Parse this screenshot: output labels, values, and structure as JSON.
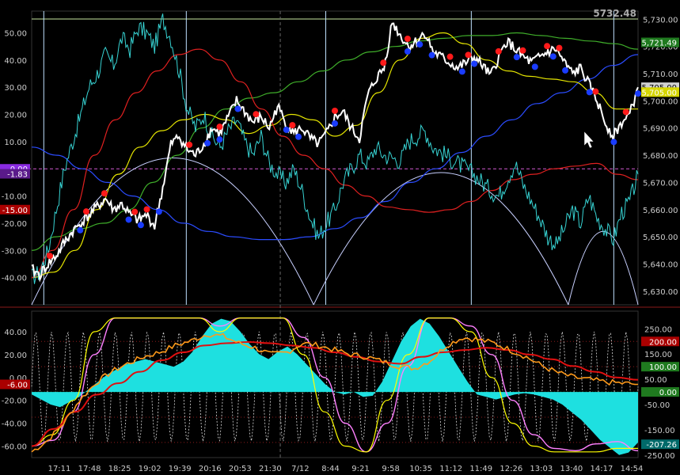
{
  "chart_data": [
    {
      "type": "line",
      "panel": "price",
      "header_value": "5732.48",
      "left_axis": {
        "ylim": [
          -50,
          58
        ],
        "ticks": [
          "50.00",
          "40.00",
          "30.00",
          "20.00",
          "10.00",
          "0.00",
          "-10.00",
          "-20.00",
          "-30.00",
          "-40.00"
        ],
        "tick_values": [
          50,
          40,
          30,
          20,
          10,
          0,
          -10,
          -20,
          -30,
          -40
        ]
      },
      "right_axis": {
        "ylim": [
          5625,
          5733
        ],
        "ticks": [
          "5,730.00",
          "5,720.00",
          "5,710.00",
          "5,700.00",
          "5,690.00",
          "5,680.00",
          "5,670.00",
          "5,660.00",
          "5,650.00",
          "5,640.00",
          "5,630.00"
        ],
        "tick_values": [
          5730,
          5720,
          5710,
          5700,
          5690,
          5680,
          5670,
          5660,
          5650,
          5640,
          5630
        ]
      },
      "badges": [
        {
          "side": "left",
          "text": "0.00",
          "value": 0,
          "bg": "#8a2be2"
        },
        {
          "side": "left",
          "text": "-1.83",
          "value": -1.83,
          "bg": "#5a1a8a"
        },
        {
          "side": "left",
          "text": "-15.00",
          "value": -15,
          "bg": "#aa0000"
        },
        {
          "side": "right",
          "text": "5,721.49",
          "value": 5721.49,
          "bg": "#1f7a1f"
        },
        {
          "side": "right",
          "text": "5,705.00",
          "value": 5705,
          "bg": "#d0d0d0"
        },
        {
          "side": "right",
          "text": "5,705.00",
          "value": 5703.2,
          "bg": "#d6d600"
        }
      ],
      "price_series": [
        5638,
        5636,
        5640,
        5643,
        5648,
        5652,
        5655,
        5658,
        5661,
        5664,
        5660,
        5662,
        5658,
        5656,
        5658,
        5654,
        5668,
        5684,
        5687,
        5682,
        5680,
        5684,
        5690,
        5688,
        5694,
        5700,
        5696,
        5692,
        5694,
        5690,
        5698,
        5692,
        5688,
        5690,
        5686,
        5684,
        5688,
        5694,
        5696,
        5690,
        5686,
        5702,
        5708,
        5712,
        5729,
        5724,
        5720,
        5722,
        5725,
        5718,
        5716,
        5714,
        5712,
        5714,
        5716,
        5713,
        5709,
        5716,
        5722,
        5719,
        5716,
        5714,
        5716,
        5718,
        5719,
        5714,
        5710,
        5712,
        5706,
        5700,
        5692,
        5687,
        5692,
        5695,
        5705
      ],
      "cyan_series": [
        -40,
        -38,
        -30,
        -15,
        0,
        10,
        20,
        30,
        35,
        42,
        38,
        48,
        44,
        52,
        50,
        45,
        55,
        48,
        36,
        22,
        15,
        20,
        12,
        8,
        14,
        18,
        10,
        5,
        12,
        2,
        -2,
        -5,
        0,
        -8,
        -18,
        -25,
        -20,
        -15,
        -5,
        0,
        5,
        2,
        8,
        5,
        4,
        3,
        10,
        12,
        14,
        8,
        6,
        4,
        2,
        0,
        -2,
        -5,
        -8,
        -10,
        -4,
        2,
        -6,
        -12,
        -18,
        -25,
        -28,
        -22,
        -15,
        -20,
        -10,
        -18,
        -22,
        -26,
        -16,
        -12,
        -2
      ],
      "red_series": [
        -40,
        -30,
        -15,
        5,
        18,
        28,
        36,
        42,
        44,
        40,
        32,
        22,
        12,
        5,
        0,
        -6,
        -10,
        -14,
        -15,
        -16,
        -15,
        -12,
        -8,
        -4,
        -2,
        0,
        1,
        2,
        -2,
        -4
      ],
      "green_series": [
        -30,
        -25,
        -22,
        -20,
        -15,
        -5,
        5,
        15,
        22,
        26,
        28,
        32,
        36,
        40,
        43,
        45,
        47,
        48,
        49,
        49,
        50,
        49,
        48,
        47,
        46,
        44
      ],
      "yellow_series": [
        -40,
        -38,
        -30,
        -15,
        -2,
        8,
        14,
        18,
        20,
        18,
        13,
        16,
        20,
        18,
        12,
        16,
        28,
        40,
        48,
        50,
        46,
        40,
        36,
        34,
        33,
        32,
        28,
        22,
        22
      ],
      "blue_series": [
        8,
        5,
        0,
        -5,
        -10,
        -15,
        -20,
        -23,
        -25,
        -26,
        -26,
        -25,
        -22,
        -18,
        -12,
        -5,
        0,
        6,
        12,
        18,
        24,
        28,
        33,
        38,
        42
      ],
      "white_arcs": [
        {
          "from": 0.0,
          "to": 0.465,
          "peak": 0.5
        },
        {
          "from": 0.465,
          "to": 0.885,
          "peak": 0.45
        },
        {
          "from": 0.885,
          "to": 1.0,
          "peak": 0.25
        }
      ],
      "red_markers": [
        0.03,
        0.09,
        0.12,
        0.17,
        0.19,
        0.26,
        0.31,
        0.37,
        0.43,
        0.5,
        0.58,
        0.62,
        0.69,
        0.72,
        0.77,
        0.81,
        0.85,
        0.87,
        0.93,
        0.98
      ],
      "blue_markers": [
        0.08,
        0.16,
        0.18,
        0.21,
        0.29,
        0.31,
        0.34,
        0.42,
        0.44,
        0.5,
        0.62,
        0.64,
        0.66,
        0.71,
        0.73,
        0.8,
        0.83,
        0.86,
        0.88,
        0.92,
        0.96,
        1.0
      ],
      "time_labels": [
        "17:11",
        "17:48",
        "18:25",
        "19:02",
        "19:39",
        "20:16",
        "20:53",
        "21:30",
        "7/12",
        "8:44",
        "9:21",
        "9:58",
        "10:35",
        "11:12",
        "11:49",
        "12:26",
        "13:03",
        "13:40",
        "14:17",
        "14:54"
      ]
    },
    {
      "type": "area",
      "panel": "oscillator",
      "left_axis": {
        "ylim": [
          -70,
          58
        ],
        "ticks": [
          "40.00",
          "20.00",
          "0.00",
          "-20.00",
          "-40.00",
          "-60.00"
        ],
        "tick_values": [
          40,
          20,
          0,
          -20,
          -40,
          -60
        ]
      },
      "right_axis": {
        "ylim": [
          -260,
          320
        ],
        "ticks": [
          "250.00",
          "150.00",
          "50.00",
          "-50.00",
          "-150.00",
          "-250.00"
        ],
        "tick_values": [
          250,
          150,
          50,
          -50,
          -150,
          -250
        ]
      },
      "badges": [
        {
          "side": "left",
          "text": "-6.00",
          "value": -6,
          "bg": "#aa0000"
        },
        {
          "side": "right",
          "text": "200.00",
          "value": 200,
          "bg": "#aa0000"
        },
        {
          "side": "right",
          "text": "100.00",
          "value": 100,
          "bg": "#1f7a1f"
        },
        {
          "side": "right",
          "text": "0.00",
          "value": 0,
          "bg": "#1f7a1f"
        },
        {
          "side": "right",
          "text": "-207.26",
          "value": -207.26,
          "bg": "#006a6a"
        }
      ],
      "histogram": [
        -10,
        -30,
        -50,
        -60,
        -40,
        -20,
        10,
        40,
        70,
        90,
        110,
        120,
        130,
        120,
        110,
        100,
        120,
        160,
        220,
        270,
        290,
        280,
        240,
        190,
        150,
        130,
        160,
        180,
        150,
        110,
        70,
        30,
        0,
        -10,
        0,
        -20,
        -15,
        40,
        120,
        200,
        260,
        290,
        270,
        220,
        160,
        100,
        40,
        -10,
        -20,
        -30,
        -20,
        -10,
        -5,
        -10,
        -20,
        -30,
        -50,
        -80,
        -110,
        -150,
        -190,
        -220,
        -250,
        -240,
        -200
      ],
      "orange_line": [
        -65,
        -55,
        -40,
        -20,
        -5,
        5,
        12,
        18,
        22,
        28,
        32,
        38,
        36,
        30,
        26,
        20,
        22,
        30,
        28,
        24,
        20,
        18,
        14,
        10,
        8,
        15,
        28,
        35,
        33,
        30,
        24,
        18,
        10,
        4,
        0,
        -2,
        -4,
        -5,
        -6
      ],
      "red_line": [
        -60,
        -45,
        -30,
        -15,
        -5,
        5,
        15,
        22,
        28,
        30,
        31,
        30,
        28,
        26,
        22,
        18,
        14,
        12,
        18,
        22,
        24,
        26,
        24,
        20,
        16,
        10,
        5,
        0,
        -2
      ],
      "yellow_line": [
        -60,
        -50,
        -20,
        40,
        52,
        52,
        52,
        52,
        52,
        40,
        52,
        52,
        52,
        20,
        -30,
        -60,
        -65,
        -20,
        20,
        52,
        52,
        40,
        0,
        -40,
        -60,
        -65,
        -65,
        -65,
        -62,
        -62
      ],
      "pink_line": [
        -60,
        -55,
        -30,
        20,
        52,
        52,
        52,
        52,
        52,
        45,
        52,
        52,
        52,
        35,
        0,
        -40,
        -65,
        -40,
        10,
        52,
        52,
        45,
        20,
        -20,
        -50,
        -62,
        -64,
        -58,
        -56,
        -64
      ]
    }
  ]
}
